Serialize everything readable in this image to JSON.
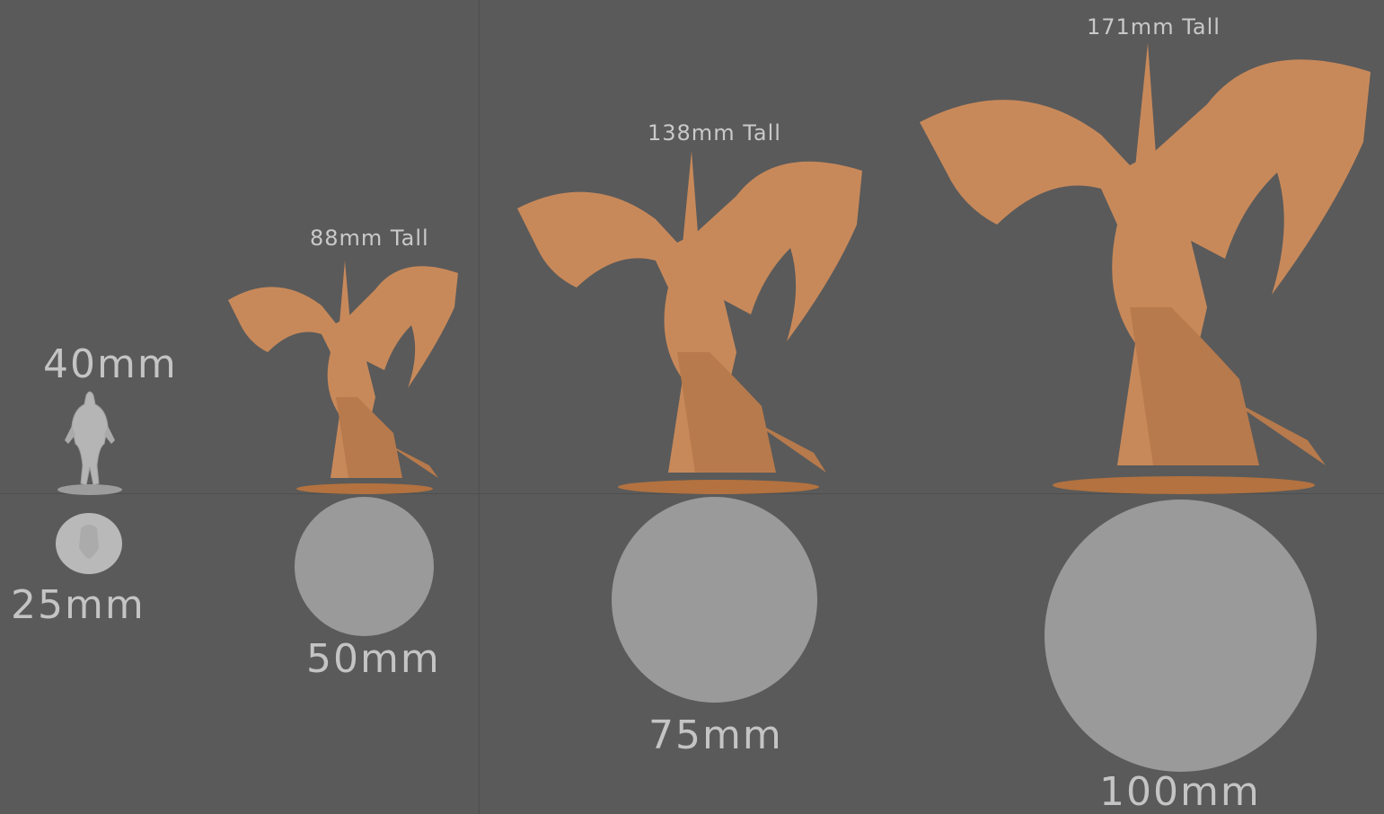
{
  "reference": {
    "height_label": "40mm",
    "base_label": "25mm"
  },
  "scales": [
    {
      "height_label": "88mm Tall",
      "base_label": "50mm"
    },
    {
      "height_label": "138mm Tall",
      "base_label": "75mm"
    },
    {
      "height_label": "171mm Tall",
      "base_label": "100mm"
    }
  ],
  "colors": {
    "background": "#5a5a5a",
    "figure": "#c8895a",
    "figure_shadow": "#9a6338",
    "base_disc": "#9a9a9a",
    "reference_figure": "#b4b4b4"
  }
}
